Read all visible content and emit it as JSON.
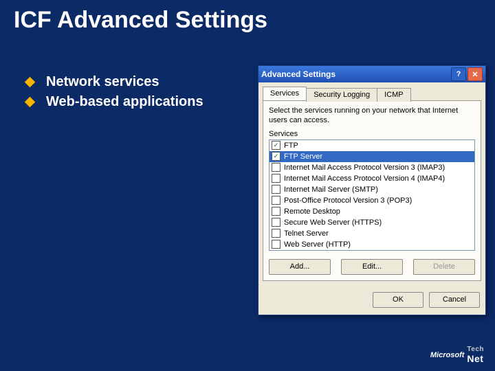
{
  "slide": {
    "title": "ICF Advanced Settings",
    "bullets": [
      "Network services",
      "Web-based applications"
    ]
  },
  "dlg": {
    "title": "Advanced Settings",
    "help_icon": "?",
    "close_icon": "✕",
    "tabs": [
      "Services",
      "Security Logging",
      "ICMP"
    ],
    "instr": "Select the services running on your network that Internet users can access.",
    "services_label": "Services",
    "services": [
      {
        "label": "FTP",
        "checked": true,
        "selected": false
      },
      {
        "label": "FTP Server",
        "checked": true,
        "selected": true
      },
      {
        "label": "Internet Mail Access Protocol Version 3 (IMAP3)",
        "checked": false,
        "selected": false
      },
      {
        "label": "Internet Mail Access Protocol Version 4 (IMAP4)",
        "checked": false,
        "selected": false
      },
      {
        "label": "Internet Mail Server (SMTP)",
        "checked": false,
        "selected": false
      },
      {
        "label": "Post-Office Protocol Version 3 (POP3)",
        "checked": false,
        "selected": false
      },
      {
        "label": "Remote Desktop",
        "checked": false,
        "selected": false
      },
      {
        "label": "Secure Web Server (HTTPS)",
        "checked": false,
        "selected": false
      },
      {
        "label": "Telnet Server",
        "checked": false,
        "selected": false
      },
      {
        "label": "Web Server (HTTP)",
        "checked": false,
        "selected": false
      }
    ],
    "buttons": {
      "add": "Add...",
      "edit": "Edit...",
      "delete": "Delete",
      "ok": "OK",
      "cancel": "Cancel"
    }
  },
  "footer": {
    "ms": "Microsoft",
    "tech": "Tech",
    "net": "Net"
  }
}
